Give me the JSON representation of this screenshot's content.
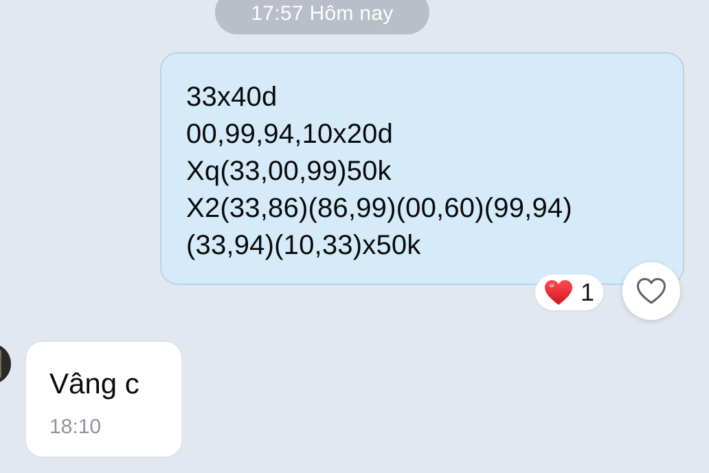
{
  "chat": {
    "time_divider": "17:57 Hôm nay",
    "outgoing_message": {
      "lines": [
        "33x40d",
        "00,99,94,10x20d",
        "Xq(33,00,99)50k",
        "X2(33,86)(86,99)(00,60)(99,94)",
        "(33,94)(10,33)x50k"
      ],
      "reaction": {
        "icon": "red-heart-icon",
        "count": "1"
      },
      "react_button_icon": "heart-outline-icon"
    },
    "incoming_message": {
      "text": "Vâng c",
      "time": "18:10"
    }
  },
  "colors": {
    "background": "#e2e7f0",
    "outgoing_bubble": "#d5ebfa",
    "incoming_bubble": "#ffffff",
    "time_divider_bg": "#b9bec8",
    "reaction_heart": "#e8222f"
  }
}
